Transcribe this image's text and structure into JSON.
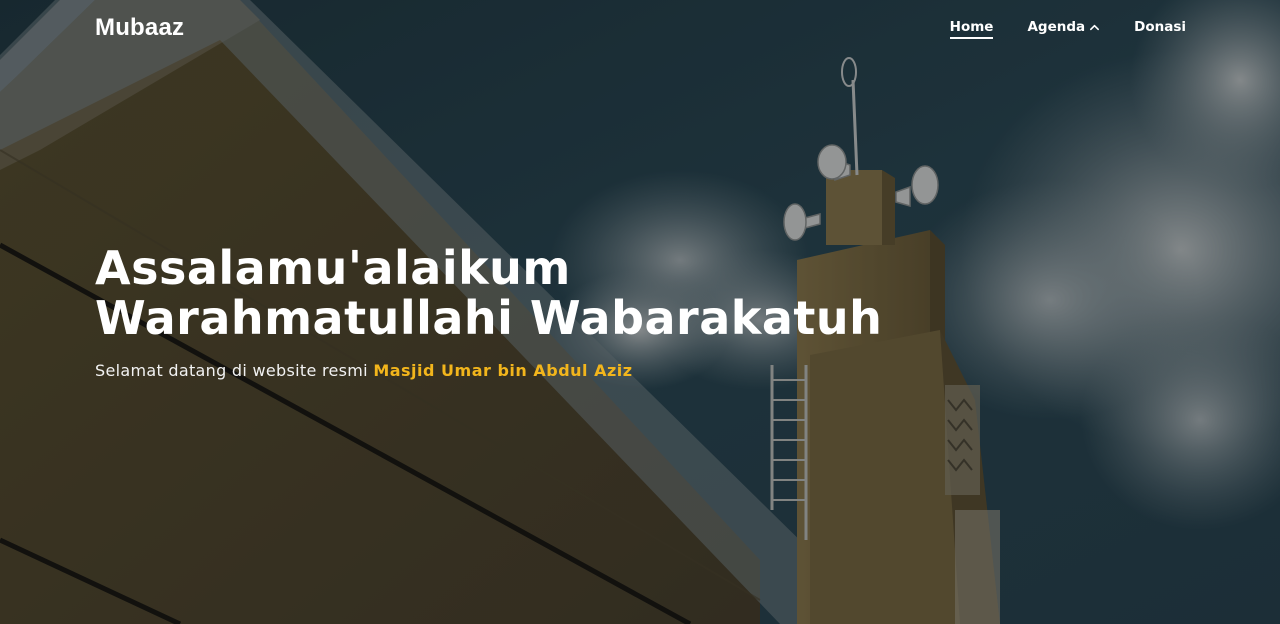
{
  "navbar": {
    "brand": "Mubaaz",
    "links": {
      "home": "Home",
      "agenda": "Agenda",
      "donasi": "Donasi"
    },
    "agenda_icon": "chevron-up-icon"
  },
  "hero": {
    "title_line1": "Assalamu'alaikum",
    "title_line2": "Warahmatullahi Wabarakatuh",
    "subtitle_prefix": "Selamat datang di website resmi",
    "subtitle_highlight": "Masjid Umar bin Abdul Aziz",
    "background_image": "mosque-minaret-with-loudspeakers-against-cloudy-sky"
  },
  "colors": {
    "highlight": "#f2b51c",
    "text": "#ffffff"
  }
}
